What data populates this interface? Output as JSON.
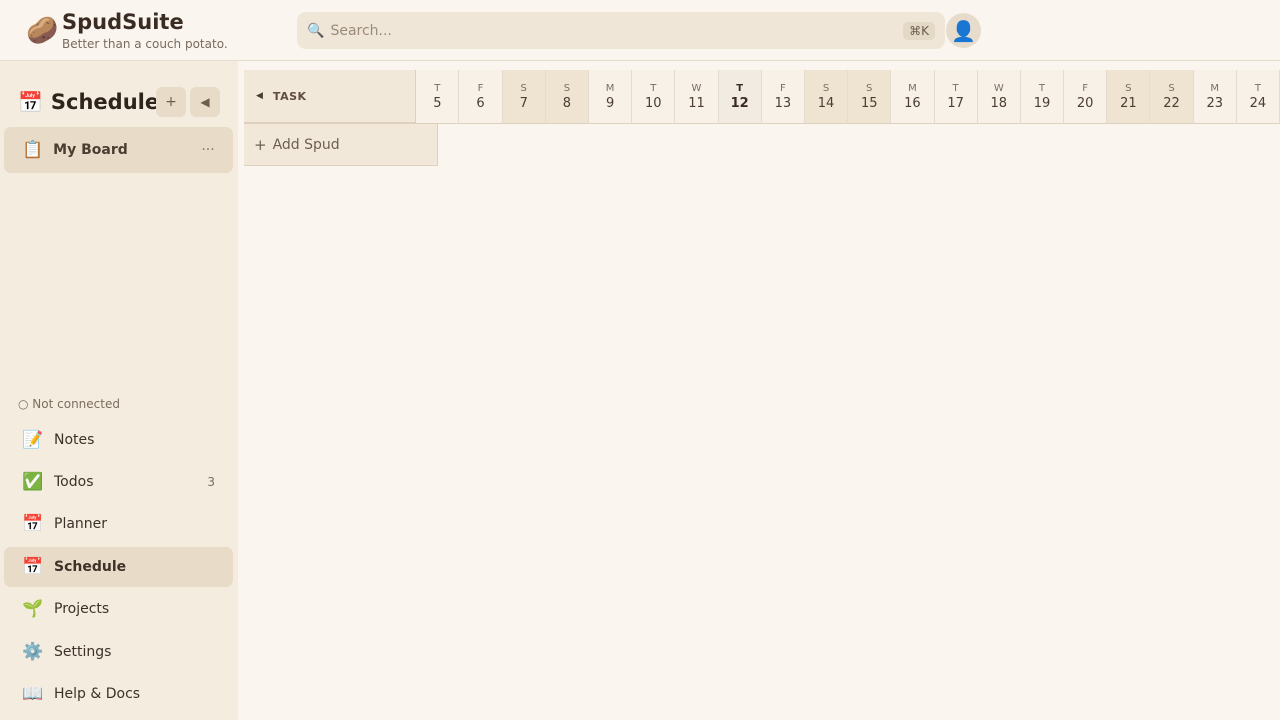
{
  "header": {
    "app_name": "SpudSuite",
    "tagline": "Better than a couch potato.",
    "logo_icon": "🥔",
    "search_placeholder": "Search...",
    "search_icon": "🔍",
    "search_shortcut": "⌘K",
    "avatar_icon": "👤"
  },
  "sidebar": {
    "title": "Schedule",
    "title_icon": "📅",
    "add_label": "+",
    "collapse_label": "◀",
    "board": {
      "icon": "📋",
      "label": "My Board",
      "more_label": "···"
    },
    "connection_status": "○ Not connected",
    "nav": [
      {
        "icon": "📝",
        "label": "Notes",
        "badge": ""
      },
      {
        "icon": "✅",
        "label": "Todos",
        "badge": "3"
      },
      {
        "icon": "📅",
        "label": "Planner",
        "badge": ""
      },
      {
        "icon": "📅",
        "label": "Schedule",
        "badge": "",
        "active": true
      },
      {
        "icon": "🌱",
        "label": "Projects",
        "badge": ""
      },
      {
        "icon": "⚙️",
        "label": "Settings",
        "badge": ""
      },
      {
        "icon": "📖",
        "label": "Help & Docs",
        "badge": ""
      }
    ]
  },
  "timeline": {
    "task_header": "TASK",
    "collapse_caret": "◀",
    "add_row_plus": "+",
    "add_row_label": "Add Spud",
    "days": [
      {
        "letter": "T",
        "num": "5"
      },
      {
        "letter": "F",
        "num": "6"
      },
      {
        "letter": "S",
        "num": "7",
        "weekend": true
      },
      {
        "letter": "S",
        "num": "8",
        "weekend": true
      },
      {
        "letter": "M",
        "num": "9"
      },
      {
        "letter": "T",
        "num": "10"
      },
      {
        "letter": "W",
        "num": "11"
      },
      {
        "letter": "T",
        "num": "12",
        "today": true
      },
      {
        "letter": "F",
        "num": "13"
      },
      {
        "letter": "S",
        "num": "14",
        "weekend": true
      },
      {
        "letter": "S",
        "num": "15",
        "weekend": true
      },
      {
        "letter": "M",
        "num": "16"
      },
      {
        "letter": "T",
        "num": "17"
      },
      {
        "letter": "W",
        "num": "18"
      },
      {
        "letter": "T",
        "num": "19"
      },
      {
        "letter": "F",
        "num": "20"
      },
      {
        "letter": "S",
        "num": "21",
        "weekend": true
      },
      {
        "letter": "S",
        "num": "22",
        "weekend": true
      },
      {
        "letter": "M",
        "num": "23"
      },
      {
        "letter": "T",
        "num": "24"
      }
    ]
  }
}
